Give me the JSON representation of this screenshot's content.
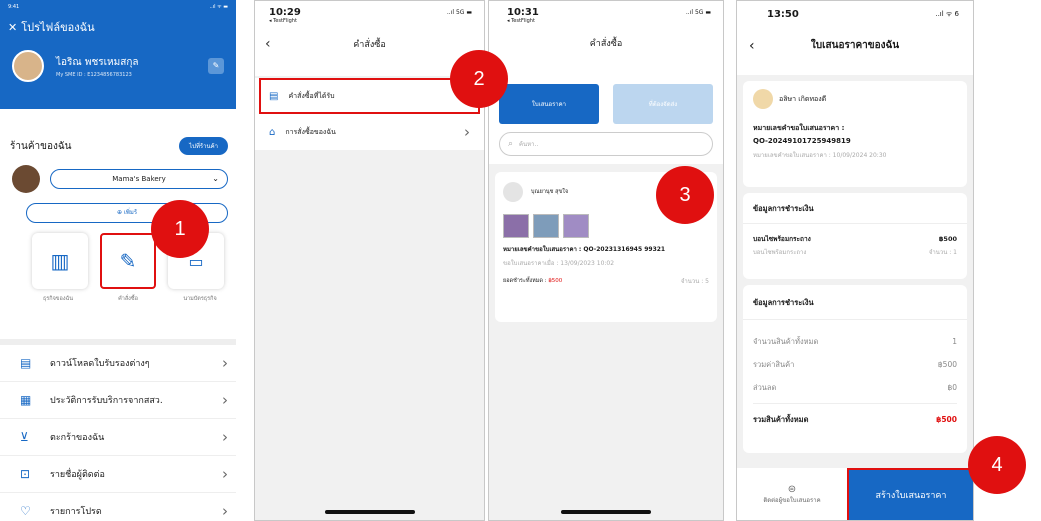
{
  "s1": {
    "time": "9:41",
    "signal": "..ıl ᯤ ▬",
    "title": "โปรไฟล์ของฉัน",
    "user_name": "ไอริณ พชรเหมสกุล",
    "member_id": "My SME ID : E1234856783123",
    "shop_heading": "ร้านค้าของฉัน",
    "goto_shop": "ไปที่ร้านค้า",
    "shop_name": "Mama's Bakery",
    "add_shop": "เพิ่มร้",
    "tiles": [
      "ธุรกิจของฉัน",
      "คำสั่งซื้อ",
      "นามบัตรธุรกิจ"
    ],
    "menu": [
      "ดาวน์โหลดใบรับรองต่างๆ",
      "ประวัติการรับบริการจากสสว.",
      "ตะกร้าของฉัน",
      "รายชื่อผู้ติดต่อ",
      "รายการโปรด"
    ]
  },
  "s2": {
    "time": "10:29",
    "back_app": "◂ TestFlight",
    "signal": "..ıl 5G ▬",
    "title": "คำสั่งซื้อ",
    "menu": [
      "คำสั่งซื้อที่ได้รับ",
      "การสั่งซื้อของฉัน"
    ]
  },
  "s3": {
    "time": "10:31",
    "back_app": "◂ TestFlight",
    "signal": "..ıl 5G ▬",
    "title": "คำสั่งซื้อ",
    "tabs": [
      "ใบเสนอราคา",
      "ที่ต้องจัดส่ง"
    ],
    "search_placeholder": "ค้นหา..",
    "buyer": "บุณยานุช สุขใจ",
    "quote_no": "หมายเลขคำขอใบเสนอราคา : QO-20231316945 99321",
    "quote_date": "ขอใบเสนอราคาเมื่อ : 13/09/2023 10:02",
    "total_label": "ยอดชำระทั้งหมด :",
    "total_value": "฿500",
    "qty": "จำนวน : 5"
  },
  "s4": {
    "time": "13:50",
    "signal": "..ıl ᯤ 6",
    "title": "ใบเสนอราคาของฉัน",
    "buyer": "อลิษา เกิดทองดี",
    "quote_label": "หมายเลขคำขอใบเสนอราคา :",
    "quote_no": "QO-20249101725949819",
    "quote_date": "หมายเลขคำขอใบเสนอราคา : 10/09/2024 20:30",
    "pay_heading": "ข้อมูลการชำระเงิน",
    "item_name": "บอนไซพร้อมกระถาง",
    "item_sub": "บอนไซพร้อมกระถาง",
    "item_price": "฿500",
    "item_qty": "จำนวน : 1",
    "pay_heading2": "ข้อมูลการชำระเงิน",
    "rows": [
      {
        "label": "จำนวนสินค้าทั้งหมด",
        "value": "1"
      },
      {
        "label": "รวมค่าสินค้า",
        "value": "฿500"
      },
      {
        "label": "ส่วนลด",
        "value": "฿0"
      }
    ],
    "total_label": "รวมสินค้าทั้งหมด",
    "total_value": "฿500",
    "contact": "ติดต่อผู้ขอใบเสนอราค",
    "create_btn": "สร้างใบเสนอราคา"
  },
  "steps": [
    "1",
    "2",
    "3",
    "4"
  ],
  "colors": {
    "brand": "#1768c4",
    "accent": "#e01010"
  }
}
